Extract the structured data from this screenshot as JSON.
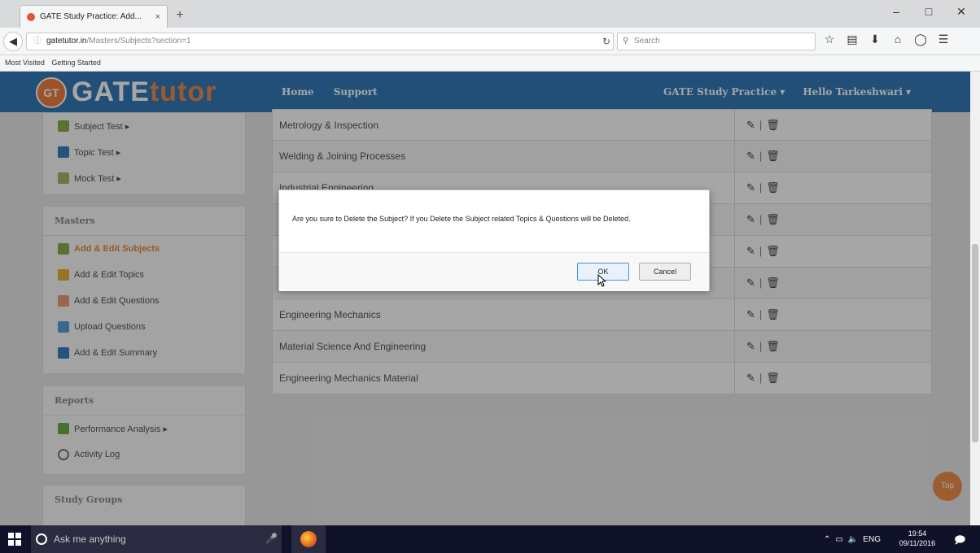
{
  "browser": {
    "tab_title": "GATE Study Practice: Add...",
    "tab_close": "×",
    "new_tab": "+",
    "url_host": "gatetutor.in",
    "url_path": "/Masters/Subjects?section=1",
    "search_placeholder": "Search",
    "bookmarks": [
      "Most Visited",
      "Getting Started"
    ]
  },
  "site": {
    "logo_badge": "GT",
    "logo_gate": "GATE",
    "logo_tutor": "tutor",
    "nav_left": [
      "Home",
      "Support"
    ],
    "nav_right": [
      "GATE Study Practice ▾",
      "Hello Tarkeshwari ▾"
    ]
  },
  "sidebar": {
    "tests": [
      "Subject Test ▸",
      "Topic Test ▸",
      "Mock Test ▸"
    ],
    "masters_title": "Masters",
    "masters": [
      "Add & Edit Subjects",
      "Add & Edit Topics",
      "Add & Edit Questions",
      "Upload Questions",
      "Add & Edit Summary"
    ],
    "reports_title": "Reports",
    "reports": [
      "Performance Analysis ▸",
      "Activity Log"
    ],
    "study_groups_title": "Study Groups"
  },
  "subjects": [
    "Metrology & Inspection",
    "Welding & Joining Processes",
    "Industrial Engineering",
    "",
    "",
    "",
    "Engineering Mechanics",
    "Material Science And Engineering",
    "Engineering Mechanics Material"
  ],
  "actions": {
    "edit": "✎",
    "sep": "|",
    "delete": "🗑"
  },
  "top_button": "Top",
  "modal": {
    "message": "Are you sure to Delete the Subject? If you Delete the Subject related Topics & Questions will be Deleted.",
    "ok": "OK",
    "cancel": "Cancel"
  },
  "taskbar": {
    "search_placeholder": "Ask me anything",
    "tray_lang": "ENG",
    "time": "19:54",
    "date": "09/11/2016"
  },
  "colors": {
    "header": "#337ab7",
    "accent": "#f08040",
    "overlay": "rgba(0,0,0,0.35)"
  }
}
